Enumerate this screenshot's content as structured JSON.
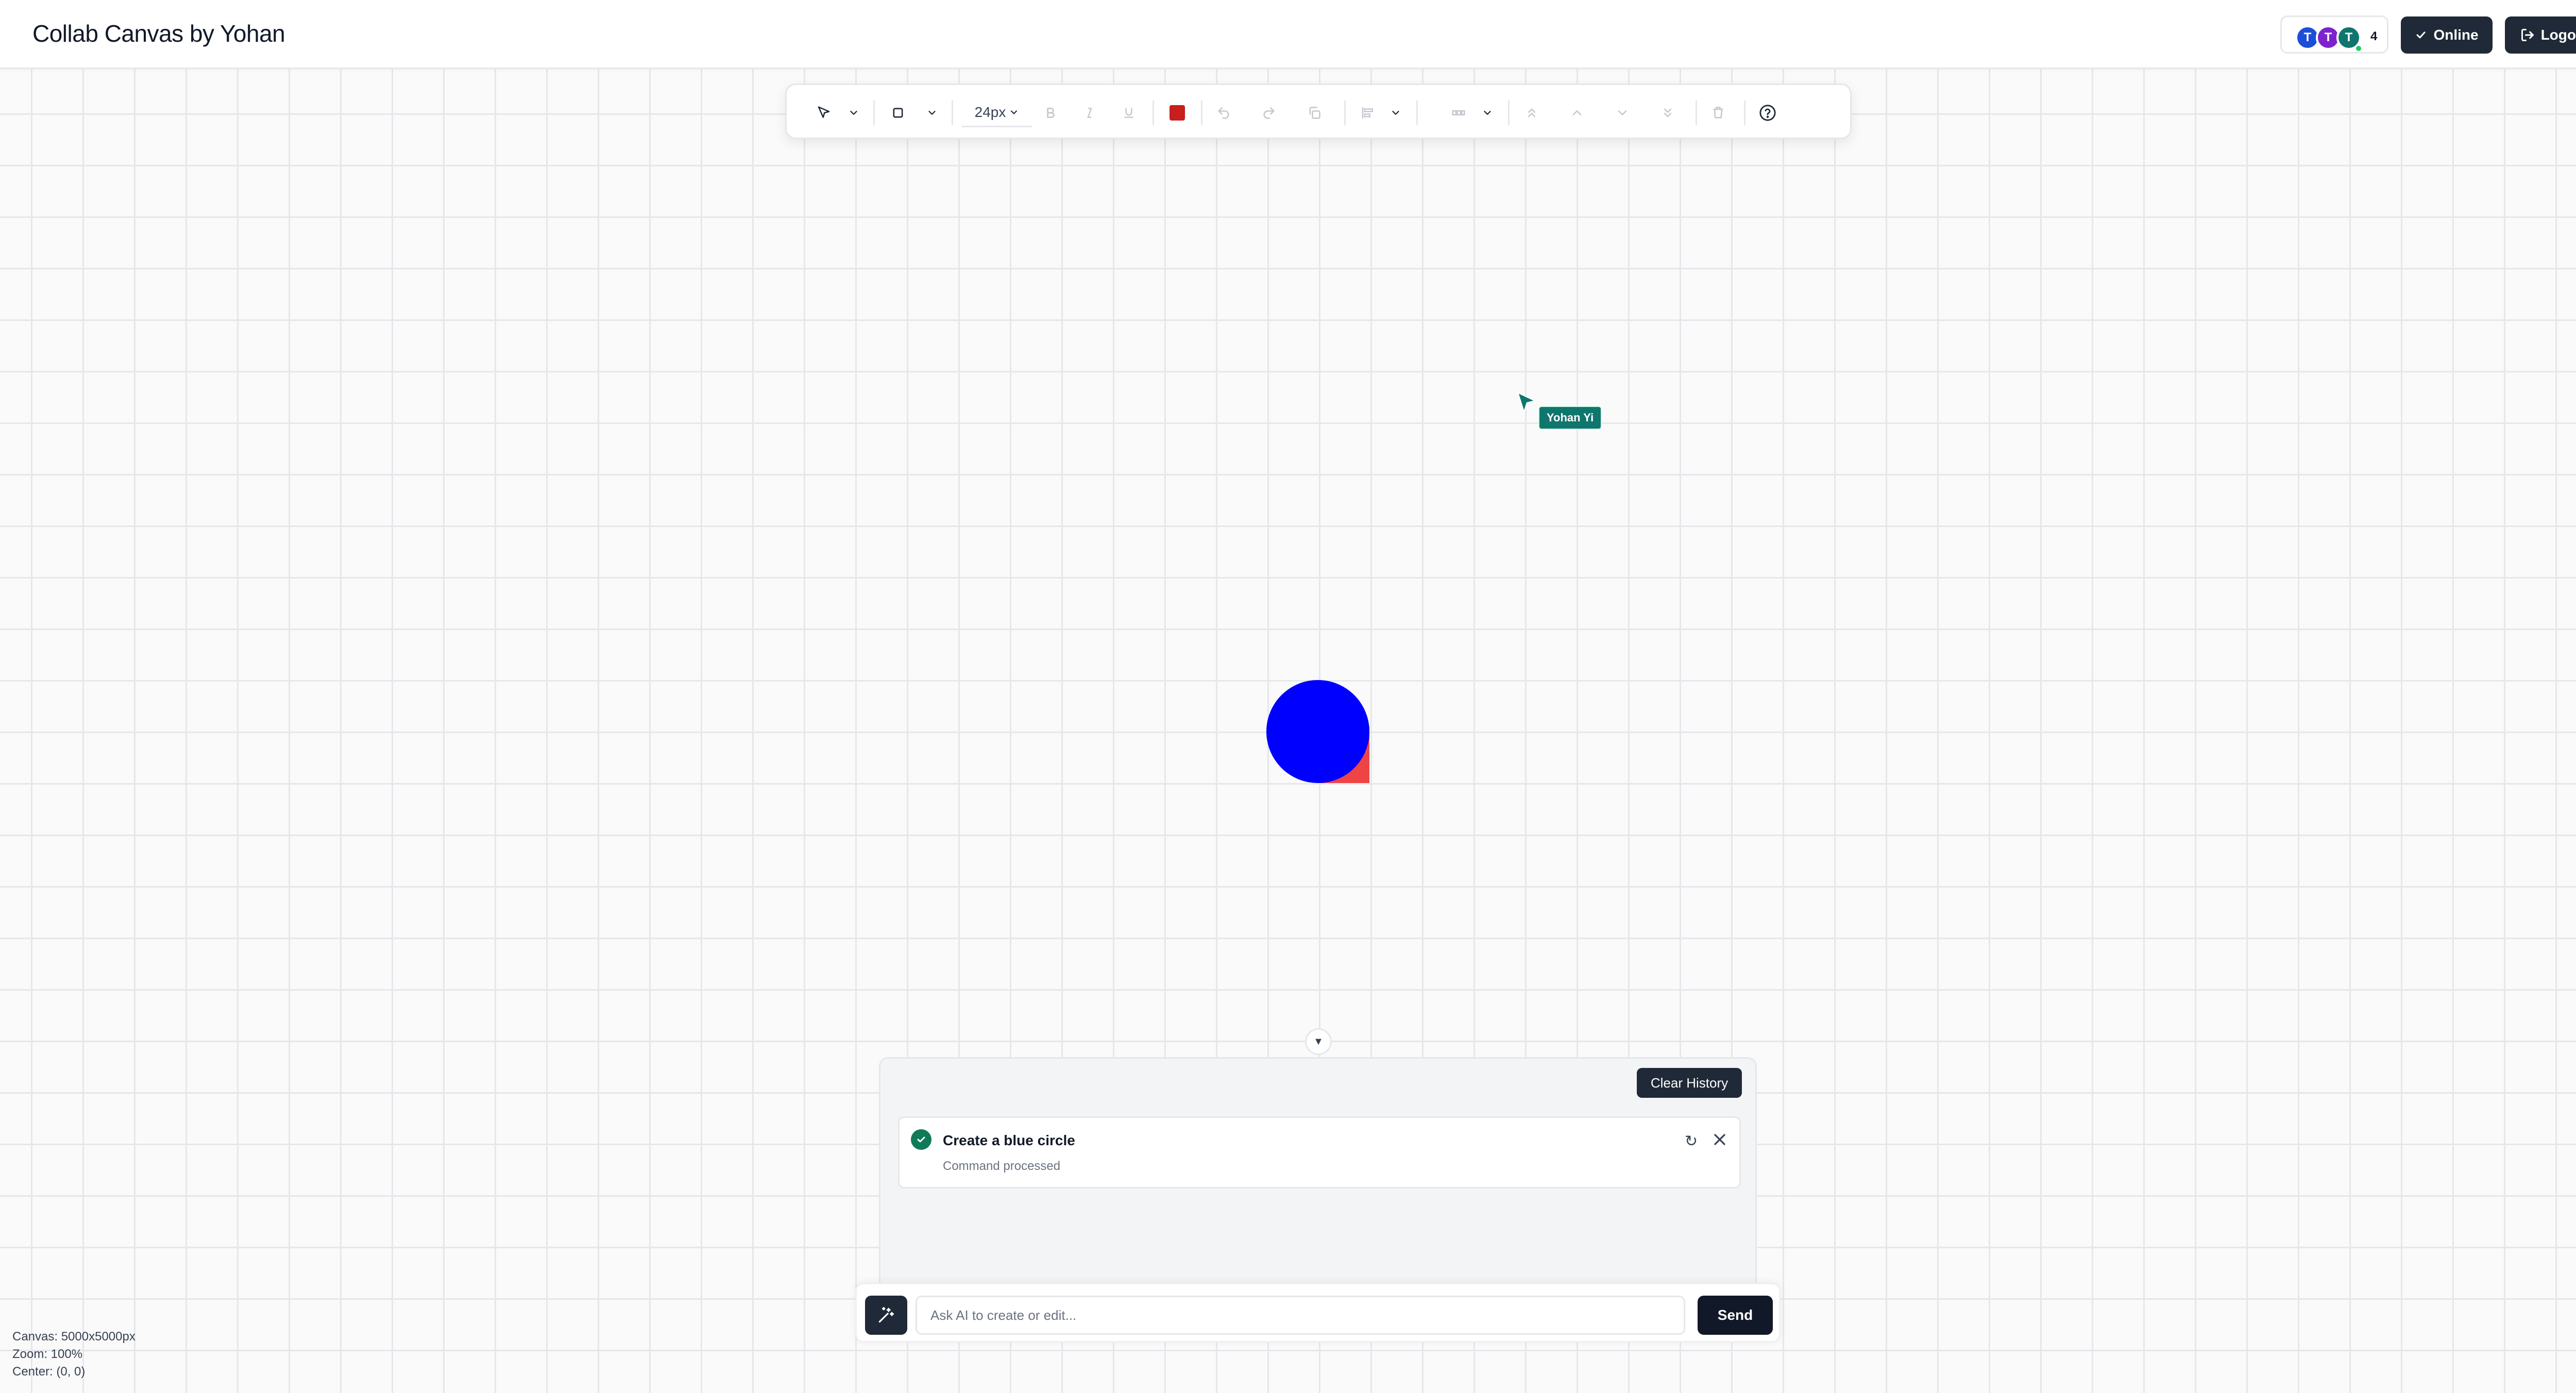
{
  "header": {
    "title": "Collab Canvas by Yohan",
    "presence": {
      "avatars": [
        {
          "initial": "T",
          "color": "#1d4ed8"
        },
        {
          "initial": "T",
          "color": "#7e22ce"
        },
        {
          "initial": "T",
          "color": "#0f766e"
        }
      ],
      "count": "4"
    },
    "online_label": "Online",
    "logout_label": "Logout"
  },
  "toolbar": {
    "select_tool_icon": "cursor-arrow-icon",
    "shape_tool_icon": "square-icon",
    "font_size": "24px",
    "fill_color": "#c81e1e"
  },
  "canvas": {
    "remote_cursor": {
      "user": "Yohan Yi",
      "color": "#0f766e"
    },
    "shapes": [
      {
        "type": "rectangle",
        "color": "#ef4444"
      },
      {
        "type": "circle",
        "color": "#0000ff"
      }
    ]
  },
  "ai_panel": {
    "clear_label": "Clear History",
    "history": [
      {
        "command": "Create a blue circle",
        "status": "Command processed"
      }
    ],
    "input_placeholder": "Ask AI to create or edit...",
    "send_label": "Send"
  },
  "status": {
    "canvas_size": "Canvas: 5000x5000px",
    "zoom": "Zoom: 100%",
    "center": "Center: (0, 0)"
  }
}
